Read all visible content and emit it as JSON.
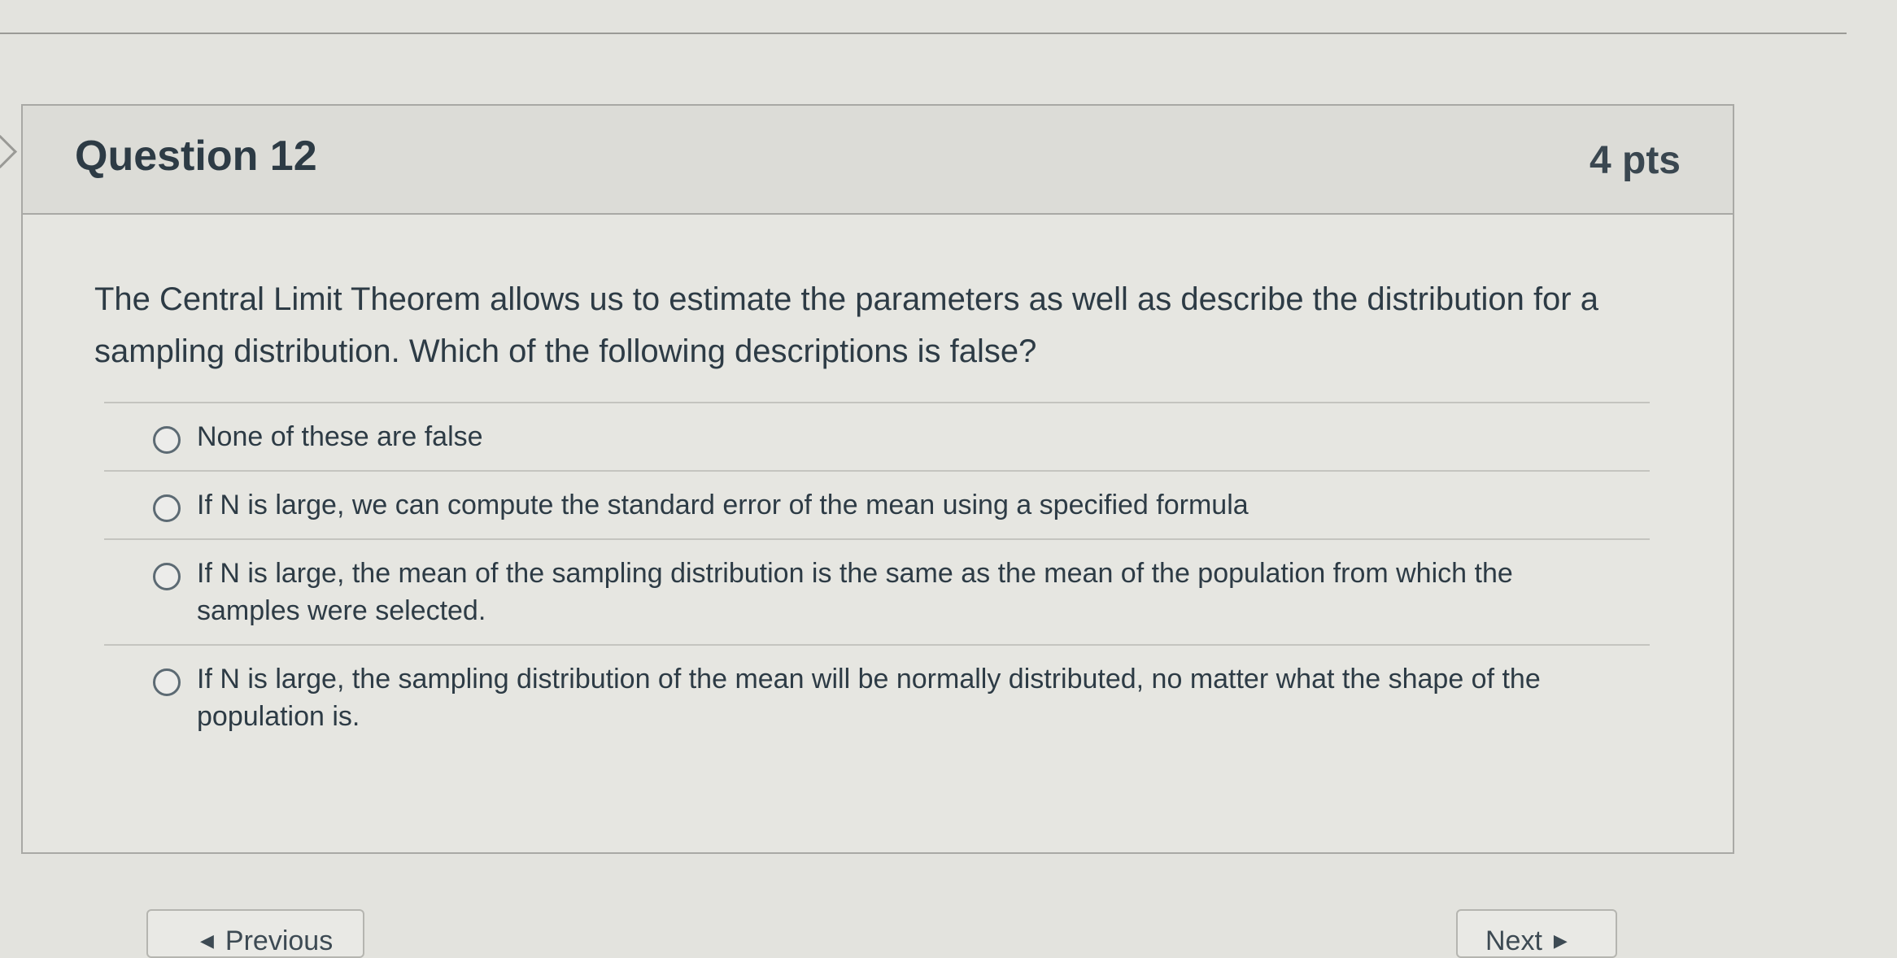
{
  "question": {
    "title": "Question 12",
    "points": "4 pts",
    "text": "The Central Limit Theorem allows us to estimate the parameters as well as describe the distribution for a sampling distribution. Which of the following descriptions is false?"
  },
  "answers": [
    {
      "label": "None of these are false"
    },
    {
      "label": "If N is large, we can compute the standard error of the mean using a specified formula"
    },
    {
      "label": "If N is large, the mean of the sampling distribution is the same as the mean of the population from which the samples were selected."
    },
    {
      "label": "If N is large, the sampling distribution of the mean will be normally distributed, no matter what the shape of the population is."
    }
  ],
  "navigation": {
    "previous_label": "Previous",
    "next_label": "Next",
    "previous_icon": "triangle-left-icon",
    "next_icon": "triangle-right-icon"
  }
}
